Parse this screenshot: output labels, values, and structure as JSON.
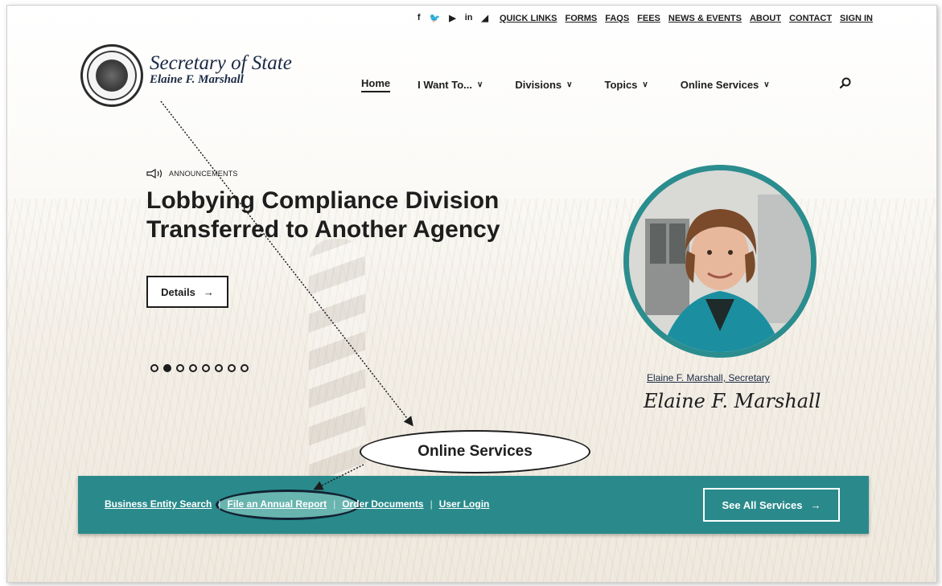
{
  "brand": {
    "title": "Secretary of State",
    "subtitle": "Elaine F. Marshall"
  },
  "social": [
    "f",
    "♥",
    "▶",
    "in",
    "ॐ"
  ],
  "utility_nav": [
    "QUICK LINKS",
    "FORMS",
    "FAQS",
    "FEES",
    "NEWS & EVENTS",
    "ABOUT",
    "CONTACT",
    "SIGN IN"
  ],
  "main_nav": {
    "home": "Home",
    "i_want_to": "I Want To...",
    "divisions": "Divisions",
    "topics": "Topics",
    "online_services": "Online Services"
  },
  "hero": {
    "tag": "ANNOUNCEMENTS",
    "headline_line1": "Lobbying Compliance Division",
    "headline_line2": "Transferred to Another Agency",
    "details_label": "Details",
    "slide_count": 8,
    "active_slide": 2
  },
  "secretary": {
    "name": "Elaine F. Marshall, Secretary",
    "signature": "Elaine F. Marshall"
  },
  "annotation": {
    "label": "Online Services"
  },
  "services": {
    "links": [
      "Business Entity Search",
      "File an Annual Report",
      "Order Documents",
      "User Login"
    ],
    "see_all": "See All Services"
  },
  "colors": {
    "teal": "#2a8a8b",
    "navy": "#1b2a44"
  }
}
